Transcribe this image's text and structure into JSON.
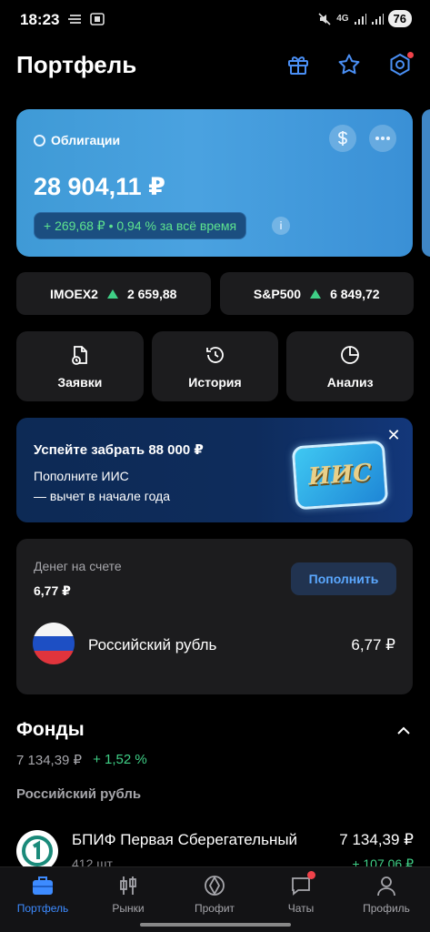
{
  "status_bar": {
    "time": "18:23",
    "battery": "76",
    "network": "4G"
  },
  "header": {
    "title": "Портфель"
  },
  "portfolio_card": {
    "label": "Облигации",
    "amount": "28 904,11 ₽",
    "change": "+ 269,68 ₽ • 0,94 % за всё время"
  },
  "indices": [
    {
      "name": "IMOEX2",
      "value": "2 659,88"
    },
    {
      "name": "S&P500",
      "value": "6 849,72"
    }
  ],
  "actions": [
    {
      "label": "Заявки"
    },
    {
      "label": "История"
    },
    {
      "label": "Анализ"
    }
  ],
  "promo": {
    "title": "Успейте забрать 88 000 ₽",
    "line1": "Пополните ИИС",
    "line2": "— вычет в начале года",
    "badge": "ИИС"
  },
  "cash": {
    "label": "Денег на счете",
    "amount": "6,77 ₽",
    "topup_label": "Пополнить",
    "currency_name": "Российский рубль",
    "currency_value": "6,77 ₽"
  },
  "funds": {
    "title": "Фонды",
    "total": "7 134,39 ₽",
    "change": "+ 1,52 %",
    "subsection": "Российский рубль",
    "items": [
      {
        "name": "БПИФ Первая Сберегательный",
        "value": "7 134,39 ₽",
        "qty": "412 шт",
        "change": "+ 107,06 ₽"
      }
    ]
  },
  "tabs": [
    {
      "label": "Портфель",
      "active": true
    },
    {
      "label": "Рынки"
    },
    {
      "label": "Профит"
    },
    {
      "label": "Чаты"
    },
    {
      "label": "Профиль"
    }
  ],
  "colors": {
    "accent": "#3d8bff",
    "positive": "#3fcf86",
    "card_blue": "#4aa2e0",
    "background": "#000000"
  }
}
